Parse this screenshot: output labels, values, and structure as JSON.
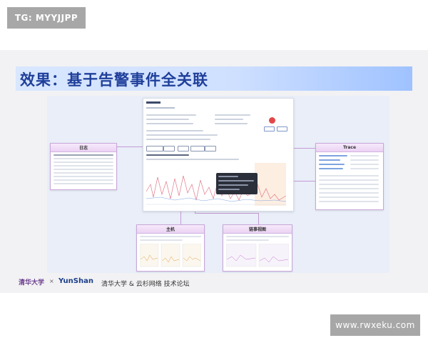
{
  "watermark_top": "TG: MYYJJPP",
  "watermark_bottom": "www.rwxeku.com",
  "slide": {
    "title": "效果：基于告警事件全关联",
    "panels": {
      "log": "日志",
      "trace": "Trace",
      "host": "主机",
      "network": "链事视图"
    }
  },
  "footer": {
    "tsinghua_logo": "清华大学",
    "times": "×",
    "yunshan_logo": "YunShan",
    "caption": "清华大学 & 云杉网络 技术论坛"
  },
  "colors": {
    "title_text": "#1f3f9a",
    "panel_border": "#c8a7d9",
    "connector": "#c59bd6",
    "alert": "#e24848",
    "chart_line": "#e07a8a"
  }
}
